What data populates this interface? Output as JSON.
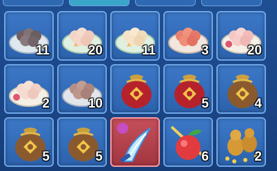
{
  "inventory": {
    "row1": [
      {
        "icon": "dumpling-plate-dark-icon",
        "count": "11"
      },
      {
        "icon": "dumpling-plate-pink-icon",
        "count": "20"
      },
      {
        "icon": "dumpling-plate-cream-icon",
        "count": "11"
      },
      {
        "icon": "dumpling-plate-red-icon",
        "count": "3"
      },
      {
        "icon": "dumpling-plate-rose-icon",
        "count": "20"
      }
    ],
    "row2": [
      {
        "icon": "dumpling-plate-rose-icon",
        "count": "2"
      },
      {
        "icon": "dumpling-plate-brown-icon",
        "count": "10"
      },
      {
        "icon": "red-lucky-bag-icon",
        "count": ""
      },
      {
        "icon": "red-lucky-bag-icon",
        "count": "5"
      },
      {
        "icon": "lucky-bag-icon",
        "count": "4"
      }
    ],
    "row3": [
      {
        "icon": "lucky-bag-icon",
        "count": "5"
      },
      {
        "icon": "lucky-bag-icon",
        "count": "5"
      },
      {
        "icon": "ice-blade-weapon-icon",
        "count": ""
      },
      {
        "icon": "magic-fruit-icon",
        "count": "6"
      },
      {
        "icon": "gold-gourd-coins-icon",
        "count": "2"
      }
    ]
  }
}
